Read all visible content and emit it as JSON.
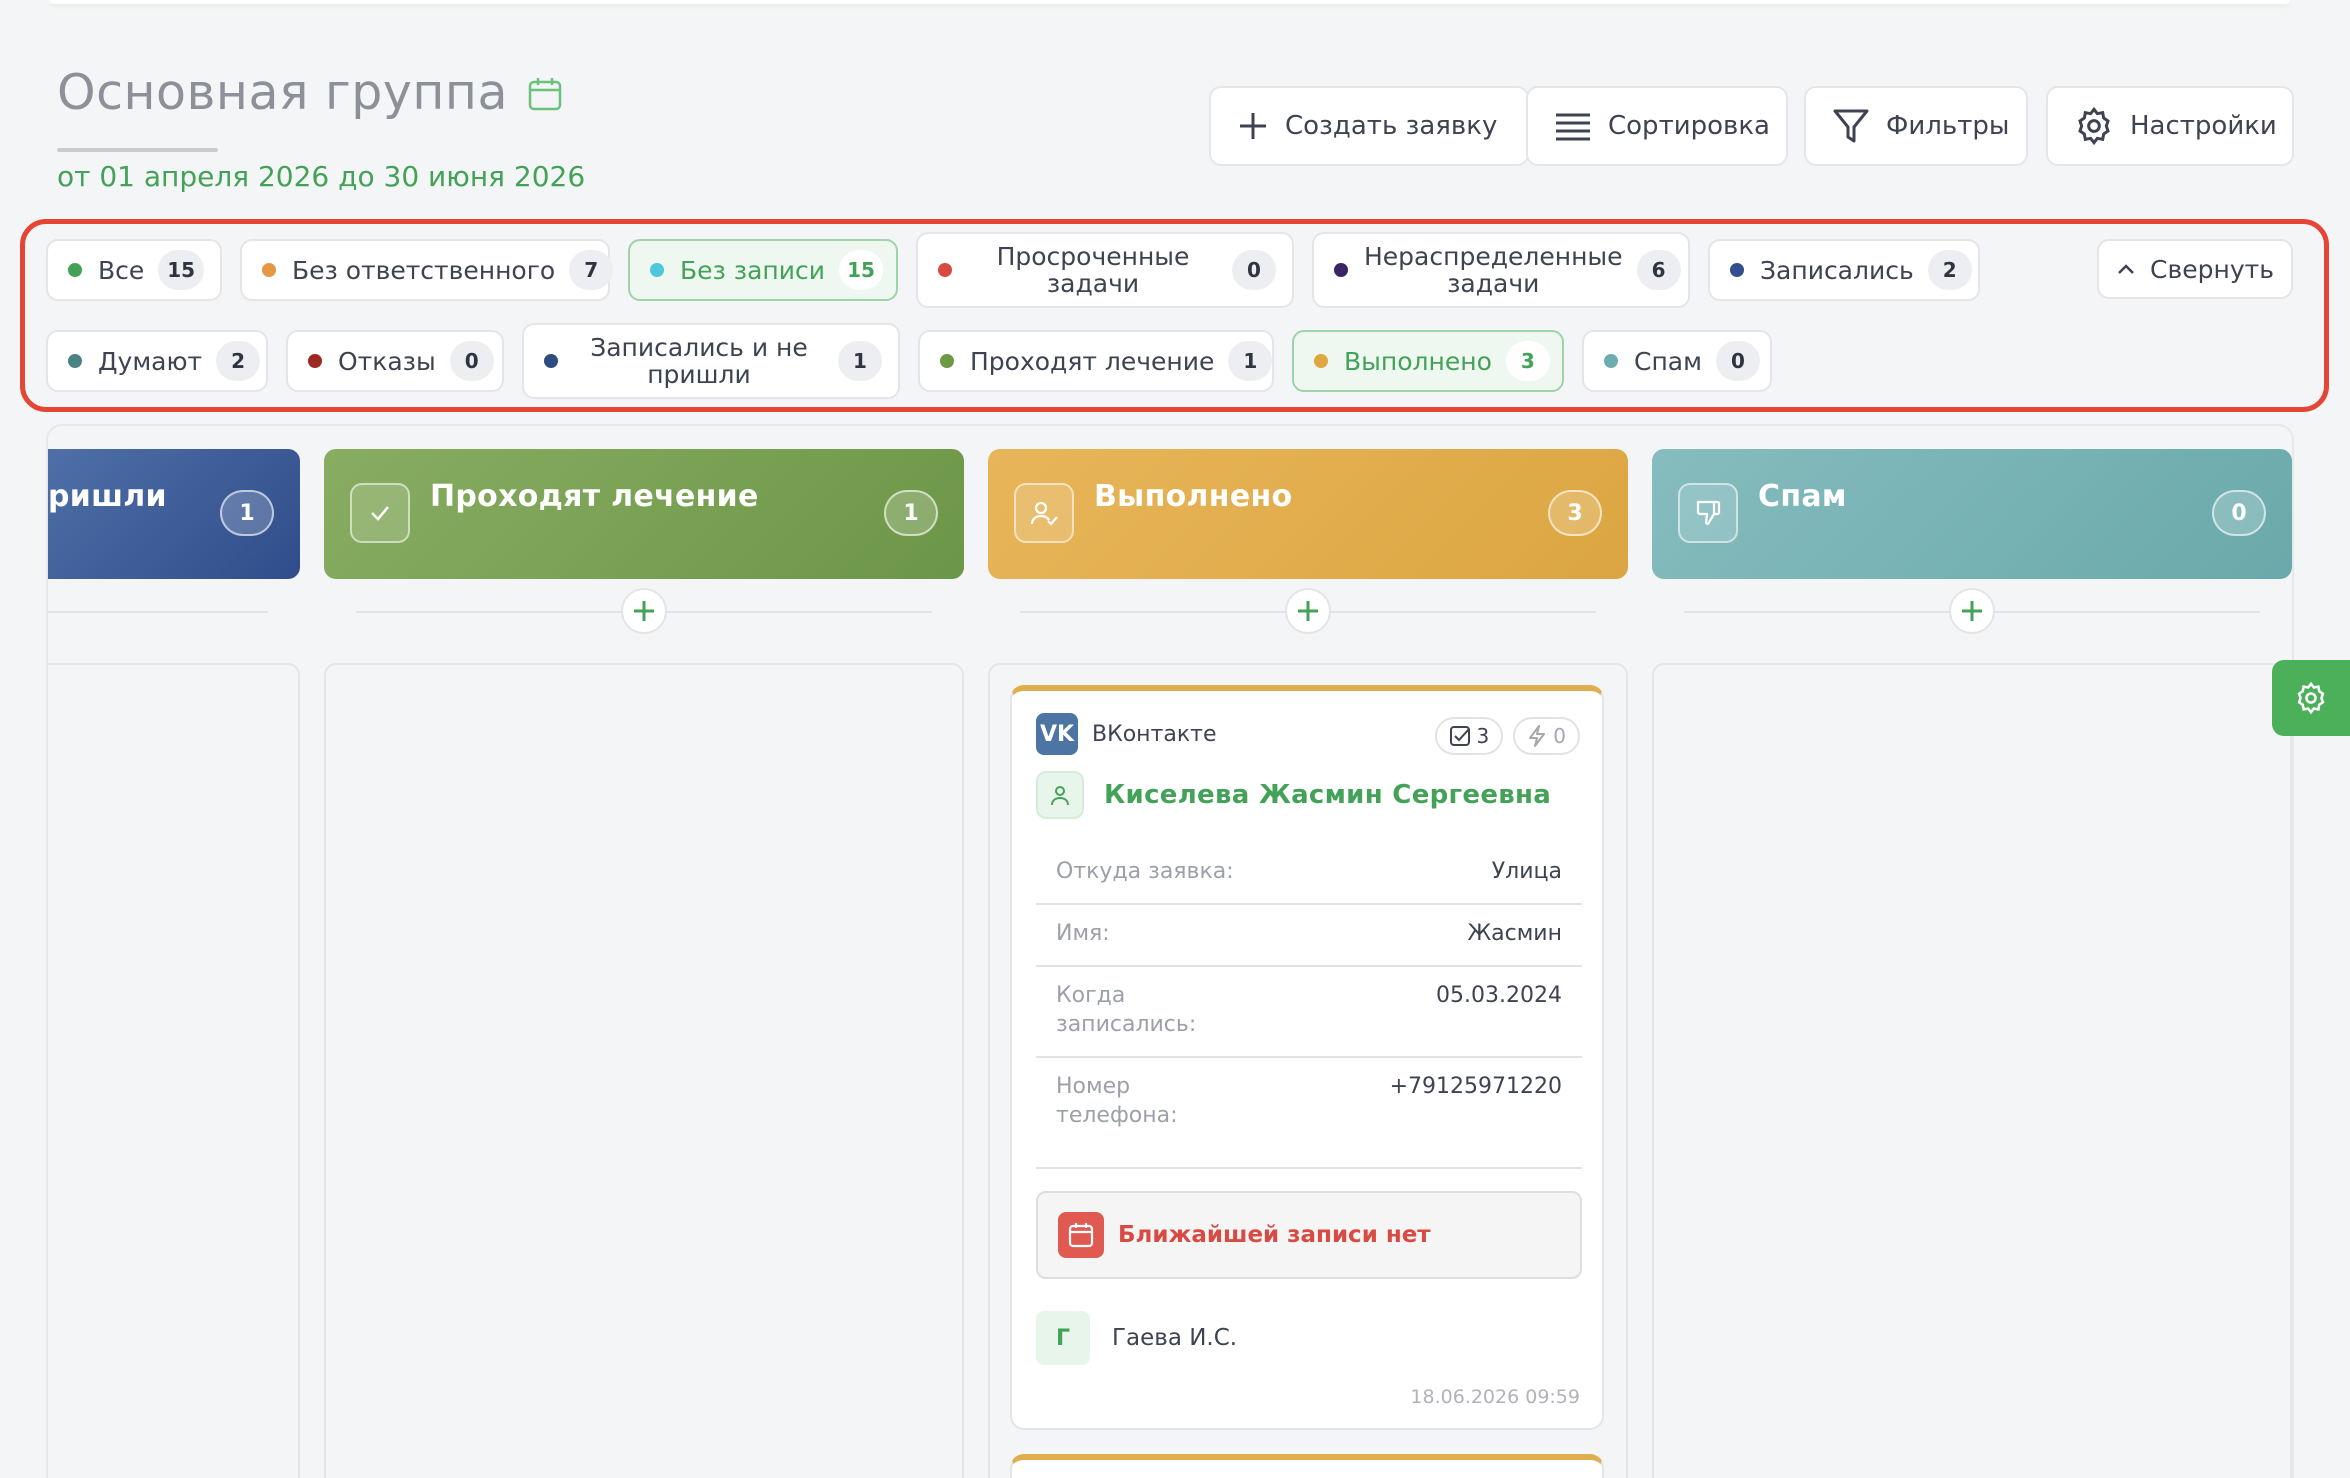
{
  "header": {
    "title": "Основная группа",
    "period": "от 01 апреля 2026 до 30 июня 2026",
    "accent_color": "#43a257"
  },
  "toolbar": {
    "create_label": "Создать заявку",
    "sort_label": "Сортировка",
    "filters_label": "Фильтры",
    "settings_label": "Настройки"
  },
  "filters": {
    "collapse_label": "Свернуть",
    "row1": [
      {
        "label": "Все",
        "count": "15",
        "color": "#43a257"
      },
      {
        "label": "Без ответственного",
        "count": "7",
        "color": "#e59844"
      },
      {
        "label": "Без записи",
        "count": "15",
        "color": "#4ec6dc",
        "active": true
      },
      {
        "label": "Просроченные задачи",
        "count": "0",
        "color": "#d94b42"
      },
      {
        "label": "Нераспределенные задачи",
        "count": "6",
        "color": "#3b2465"
      },
      {
        "label": "Записались",
        "count": "2",
        "color": "#344f8f"
      }
    ],
    "row2": [
      {
        "label": "Думают",
        "count": "2",
        "color": "#4b8284"
      },
      {
        "label": "Отказы",
        "count": "0",
        "color": "#9c2a22"
      },
      {
        "label": "Записались и не пришли",
        "count": "1",
        "color": "#2e4d82"
      },
      {
        "label": "Проходят лечение",
        "count": "1",
        "color": "#6c9a45"
      },
      {
        "label": "Выполнено",
        "count": "3",
        "color": "#e0a640",
        "active": true
      },
      {
        "label": "Спам",
        "count": "0",
        "color": "#6aaeb2"
      }
    ]
  },
  "columns": [
    {
      "title": "ришли",
      "count": "1",
      "color": "#3b5a94"
    },
    {
      "title": "Проходят лечение",
      "count": "1",
      "color": "#78a150"
    },
    {
      "title": "Выполнено",
      "count": "3",
      "color": "#e0ab4c"
    },
    {
      "title": "Спам",
      "count": "0",
      "color": "#7ab3b5"
    }
  ],
  "card": {
    "source": "ВКонтакте",
    "tasks_count": "3",
    "actions_count": "0",
    "client_name": "Киселева Жасмин Сергеевна",
    "fields": [
      {
        "key": "Откуда заявка:",
        "value": "Улица"
      },
      {
        "key": "Имя:",
        "value": "Жасмин"
      },
      {
        "key": "Когда записались:",
        "value": "05.03.2024"
      },
      {
        "key": "Номер телефона:",
        "value": "+79125971220"
      }
    ],
    "no_record_label": "Ближайшей записи нет",
    "responsible_initial": "Г",
    "responsible_name": "Гаева И.С.",
    "date": "18.06.2026 09:59"
  }
}
